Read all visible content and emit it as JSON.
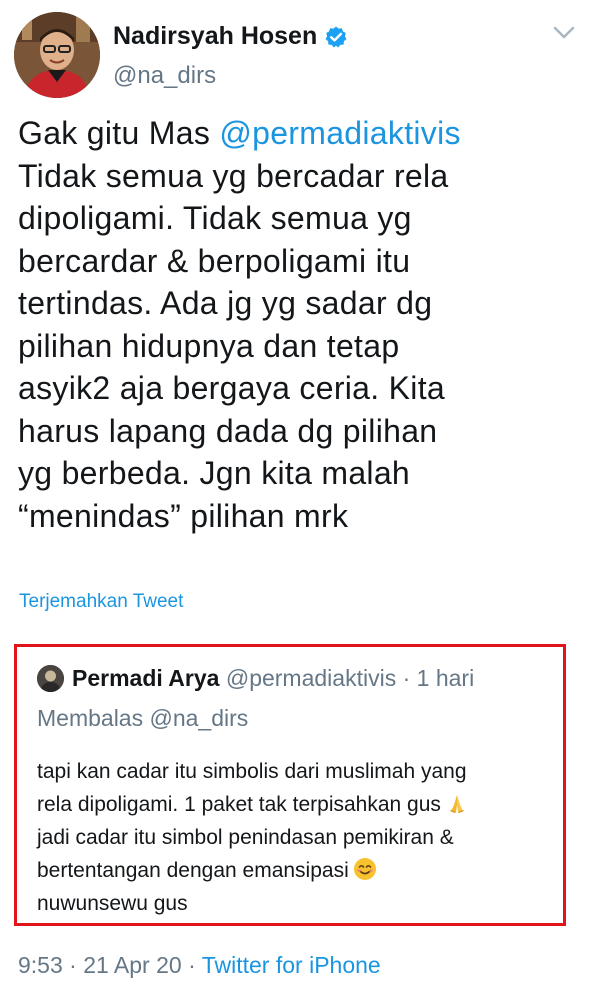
{
  "tweet": {
    "author_name": "Nadirsyah Hosen",
    "author_handle": "@na_dirs",
    "verified": true,
    "text_lines": [
      [
        "Gak gitu Mas ",
        "@permadiaktivis"
      ],
      "Tidak semua yg bercadar rela",
      "dipoligami. Tidak semua yg",
      "bercardar & berpoligami itu",
      "tertindas. Ada jg yg sadar dg",
      "pilihan hidupnya dan tetap",
      "asyik2 aja bergaya ceria. Kita",
      "harus lapang dada dg pilihan",
      "yg berbeda. Jgn kita malah",
      "“menindas” pilihan mrk"
    ],
    "translate_label": "Terjemahkan Tweet"
  },
  "quoted": {
    "author_name": "Permadi Arya",
    "author_handle": "@permadiaktivis",
    "separator": "·",
    "time_ago": "1 hari",
    "reply_to": "Membalas @na_dirs",
    "text_lines": [
      "tapi kan cadar itu simbolis dari muslimah yang",
      "rela dipoligami. 1 paket tak terpisahkan gus",
      "jadi cadar itu simbol penindasan pemikiran &",
      "bertentangan dengan emansipasi",
      "nuwunsewu gus"
    ],
    "emoji_names": [
      "folded-hands-emoji",
      "smiling-face-emoji"
    ]
  },
  "footer": {
    "time": "9:53",
    "separator": "·",
    "date": "21 Apr 20",
    "source": "Twitter for iPhone"
  },
  "colors": {
    "link": "#1b95e0",
    "muted": "#657786",
    "text": "#14171a",
    "highlight_border": "#e0141a"
  }
}
